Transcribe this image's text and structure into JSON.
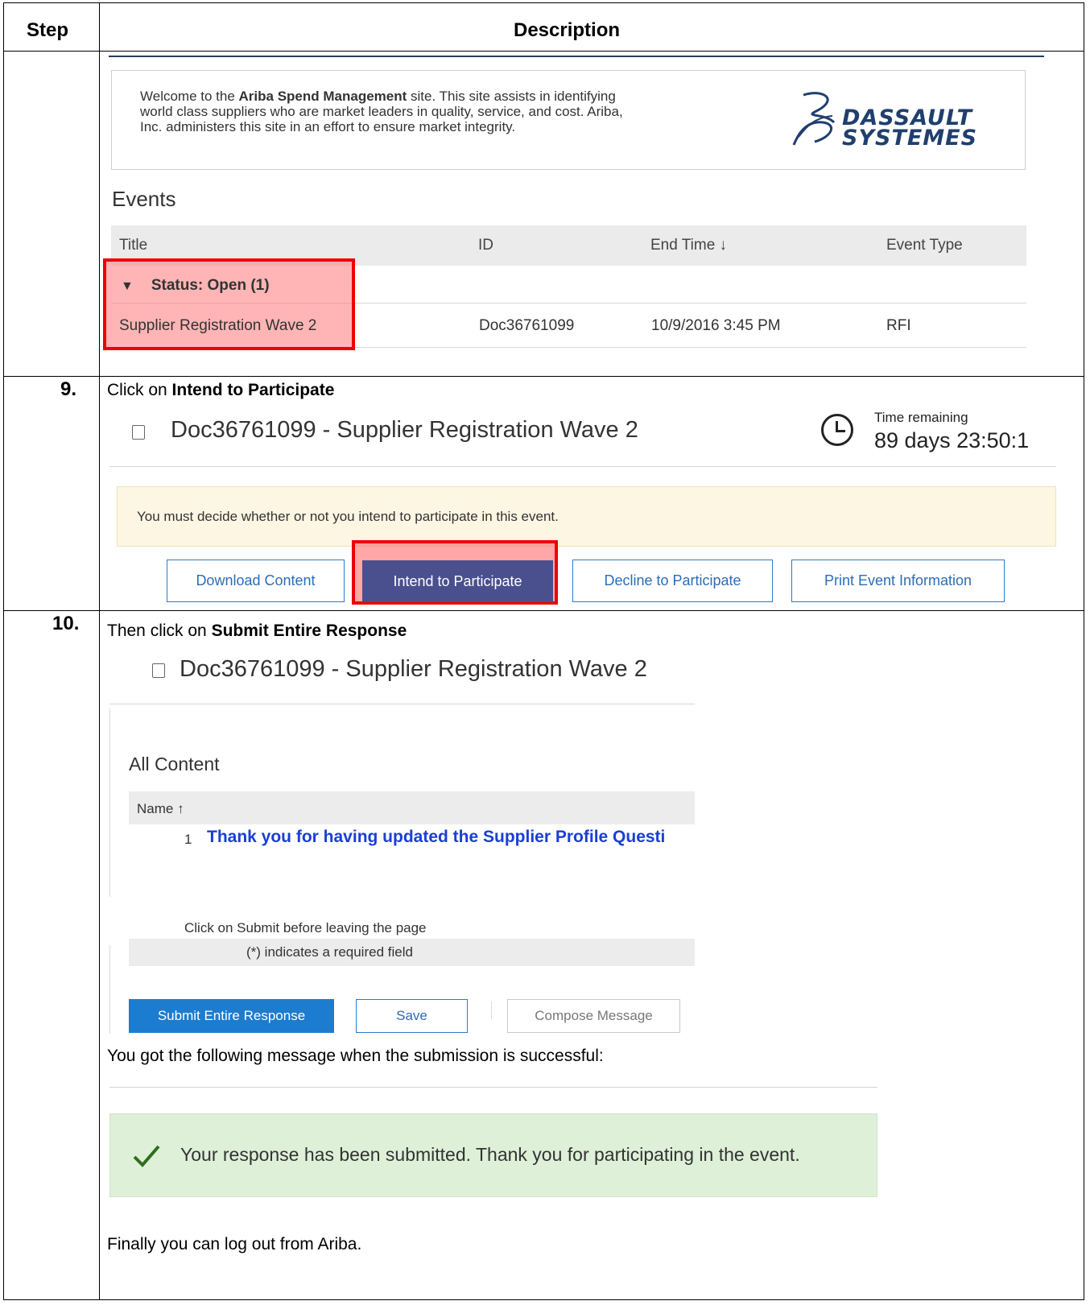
{
  "table": {
    "col_step": "Step",
    "col_description": "Description"
  },
  "section1": {
    "welcome_prefix": "Welcome to the ",
    "welcome_bold": "Ariba Spend Management",
    "welcome_line1_rest": " site.  This site assists in identifying",
    "welcome_line2": "world class suppliers who are market leaders in quality, service, and cost. Ariba,",
    "welcome_line3": "Inc. administers this site in an effort to ensure market integrity.",
    "logo_line1": "DASSAULT",
    "logo_line2": "SYSTEMES",
    "events_title": "Events",
    "columns": {
      "title": "Title",
      "id": "ID",
      "end_time": "End Time ↓",
      "event_type": "Event Type"
    },
    "status_group": "Status: Open  (1)",
    "row": {
      "title": "Supplier Registration Wave 2",
      "id": "Doc36761099",
      "end_time": "10/9/2016 3:45 PM",
      "event_type": "RFI"
    }
  },
  "step9": {
    "number": "9.",
    "instruction_prefix": "Click on ",
    "instruction_bold": "Intend to Participate",
    "doc_title": "Doc36761099 - Supplier Registration Wave 2",
    "time_label": "Time remaining",
    "time_value": "89 days 23:50:1",
    "notice": "You must decide whether or not you intend to participate in this event.",
    "buttons": {
      "download": "Download Content",
      "intend": "Intend to Participate",
      "decline": "Decline to Participate",
      "print": "Print Event Information"
    }
  },
  "step10": {
    "number": "10.",
    "instruction_prefix": "Then click on ",
    "instruction_bold": "Submit Entire Response",
    "doc_title": "Doc36761099 - Supplier Registration Wave 2",
    "all_content": "All Content",
    "name_header": "Name ↑",
    "item_number": "1",
    "item_text": "Thank you for having updated the Supplier Profile Questi",
    "submit_note": "Click on Submit before leaving the page",
    "required_note": "(*) indicates a required field",
    "buttons": {
      "submit": "Submit Entire Response",
      "save": "Save",
      "compose": "Compose Message"
    },
    "after_text": "You got the following message when the submission is successful:",
    "success_message": "Your response has been submitted.  Thank you for participating in the event.",
    "final_text": "Finally you can log out from Ariba."
  },
  "colors": {
    "highlight_red": "#ee0000",
    "ariba_blue": "#1c7ccf",
    "intend_button": "#4a4f8e",
    "success_bg": "#def0d8",
    "notice_bg": "#fcf6e3",
    "link_blue": "#1a3ed6"
  }
}
